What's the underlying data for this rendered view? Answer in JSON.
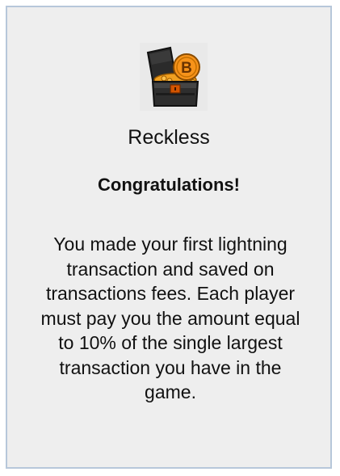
{
  "card": {
    "icon": "treasure-chest-bitcoin-icon",
    "title": "Reckless",
    "heading": "Congratulations!",
    "description": "You made your first lightning transaction and saved on transactions fees. Each player must pay you the amount equal to 10% of the single largest transaction you have in the game.",
    "colors": {
      "background": "#eeeeee",
      "border": "#b7c7da",
      "coin": "#f7931a"
    }
  }
}
